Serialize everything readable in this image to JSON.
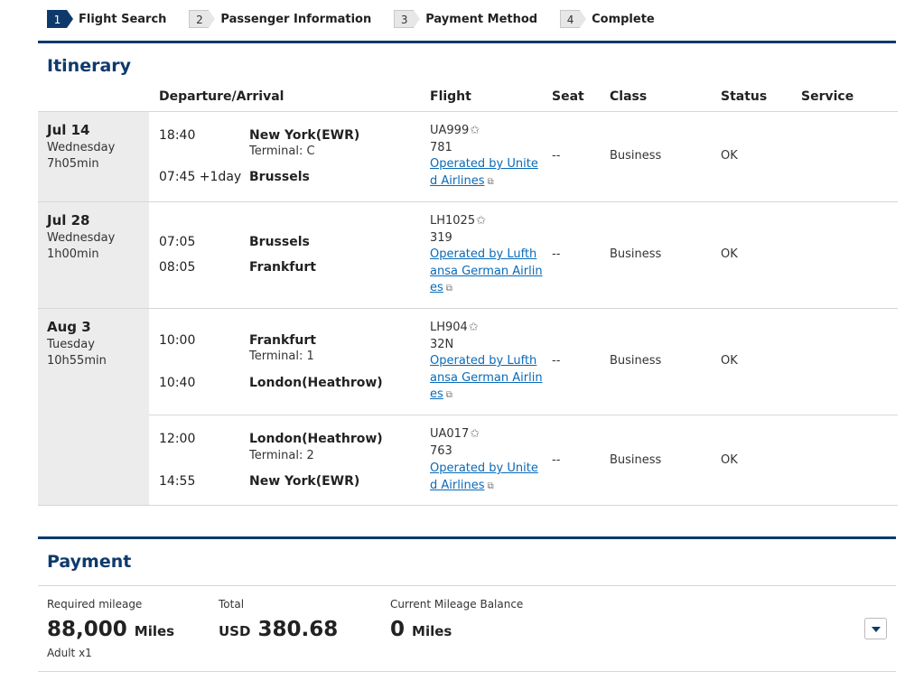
{
  "stepper": [
    {
      "num": "1",
      "label": "Flight Search"
    },
    {
      "num": "2",
      "label": "Passenger Information"
    },
    {
      "num": "3",
      "label": "Payment Method"
    },
    {
      "num": "4",
      "label": "Complete"
    }
  ],
  "itinerary": {
    "title": "Itinerary",
    "headers": {
      "dep_arr": "Departure/Arrival",
      "flight": "Flight",
      "seat": "Seat",
      "class": "Class",
      "status": "Status",
      "service": "Service"
    },
    "days": [
      {
        "date": "Jul 14",
        "weekday": "Wednesday",
        "duration": "7h05min",
        "segments": [
          {
            "dep_time": "18:40",
            "dep_place": "New York(EWR)",
            "dep_terminal": "Terminal: C",
            "arr_time": "07:45 +1day",
            "arr_place": "Brussels",
            "arr_terminal": "",
            "flight": "UA999",
            "equipment": "781",
            "operated_by": "Operated by United Airlines",
            "seat": "--",
            "class": "Business",
            "status": "OK"
          }
        ]
      },
      {
        "date": "Jul 28",
        "weekday": "Wednesday",
        "duration": "1h00min",
        "segments": [
          {
            "dep_time": "07:05",
            "dep_place": "Brussels",
            "dep_terminal": "",
            "arr_time": "08:05",
            "arr_place": "Frankfurt",
            "arr_terminal": "",
            "flight": "LH1025",
            "equipment": "319",
            "operated_by": "Operated by Lufthansa German Airlines",
            "seat": "--",
            "class": "Business",
            "status": "OK"
          }
        ]
      },
      {
        "date": "Aug 3",
        "weekday": "Tuesday",
        "duration": "10h55min",
        "segments": [
          {
            "dep_time": "10:00",
            "dep_place": "Frankfurt",
            "dep_terminal": "Terminal: 1",
            "arr_time": "10:40",
            "arr_place": "London(Heathrow)",
            "arr_terminal": "",
            "flight": "LH904",
            "equipment": "32N",
            "operated_by": "Operated by Lufthansa German Airlines",
            "seat": "--",
            "class": "Business",
            "status": "OK"
          },
          {
            "dep_time": "12:00",
            "dep_place": "London(Heathrow)",
            "dep_terminal": "Terminal: 2",
            "arr_time": "14:55",
            "arr_place": "New York(EWR)",
            "arr_terminal": "",
            "flight": "UA017",
            "equipment": "763",
            "operated_by": "Operated by United Airlines",
            "seat": "--",
            "class": "Business",
            "status": "OK"
          }
        ]
      }
    ]
  },
  "payment": {
    "title": "Payment",
    "required_mileage": {
      "label": "Required mileage",
      "value": "88,000",
      "unit": "Miles",
      "sub": "Adult x1"
    },
    "total": {
      "label": "Total",
      "currency": "USD",
      "value": "380.68"
    },
    "balance": {
      "label": "Current Mileage Balance",
      "value": "0",
      "unit": "Miles"
    }
  },
  "icons": {
    "star": "star-outline-icon",
    "external": "external-link-icon",
    "dropdown": "chevron-down-icon"
  },
  "colors": {
    "brand": "#0e3a6b",
    "link": "#0a6ab8",
    "date_bg": "#ececec"
  }
}
